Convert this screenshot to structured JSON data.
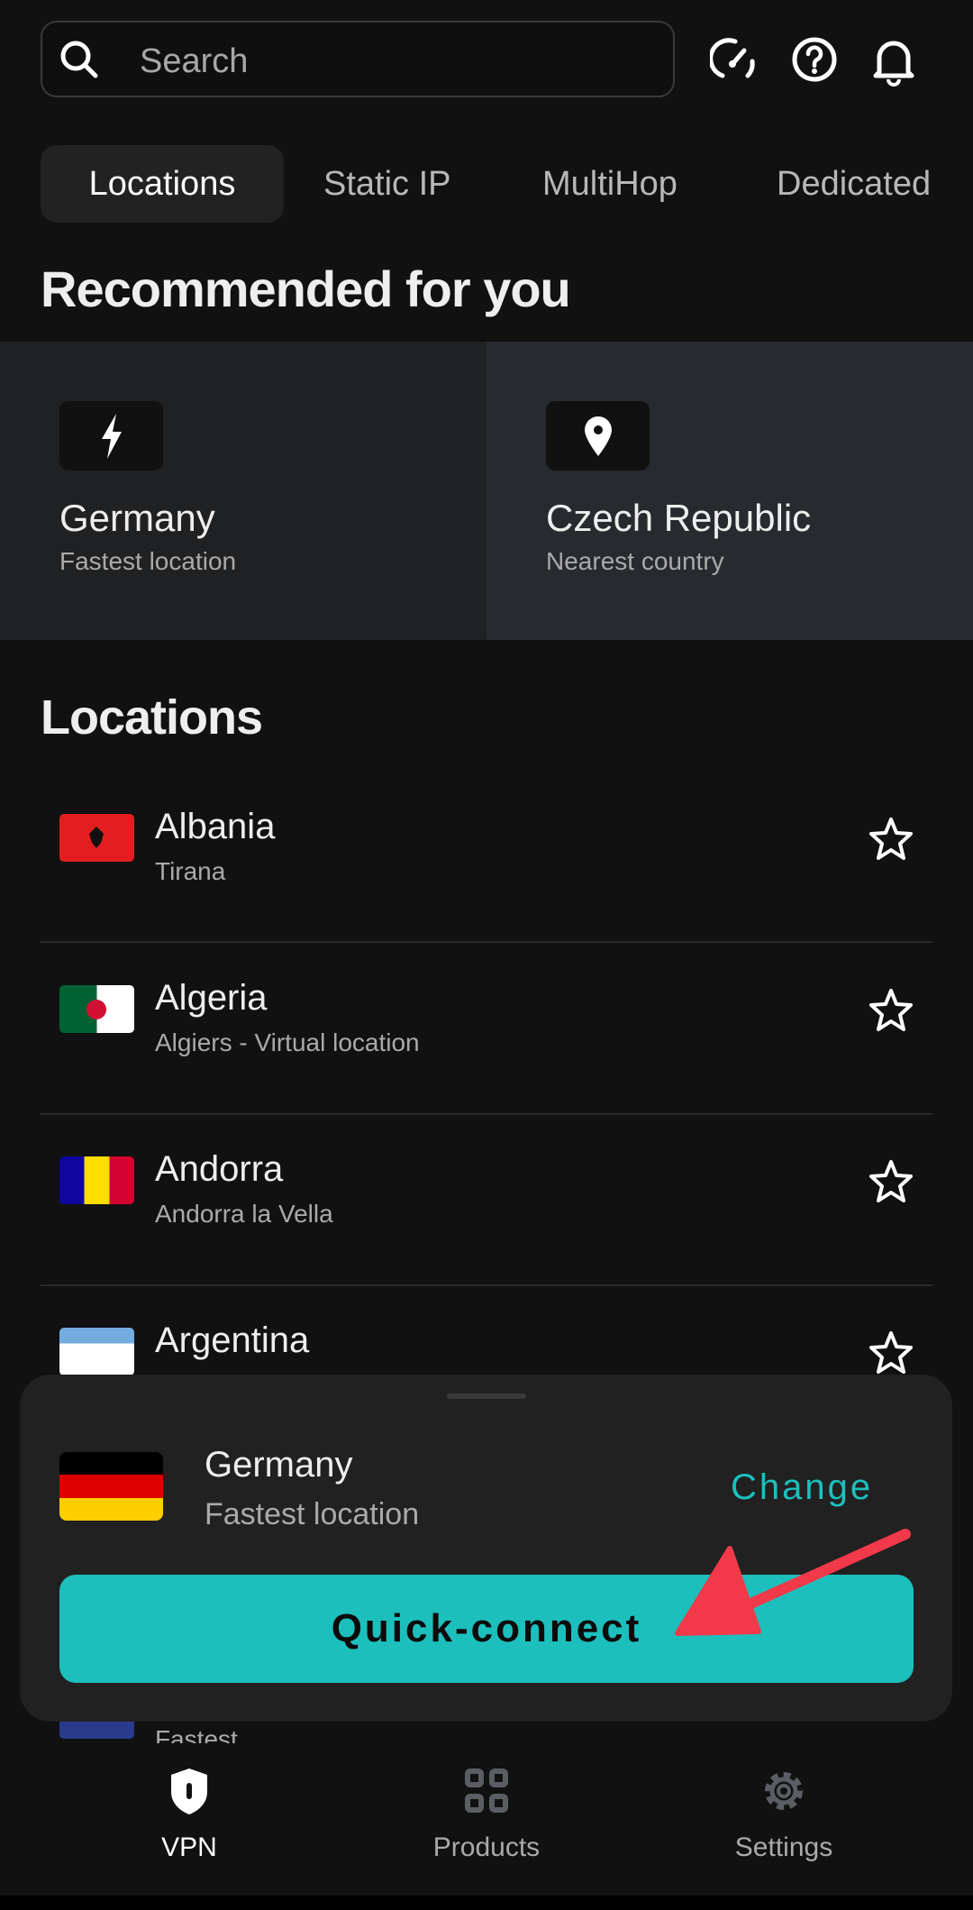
{
  "header": {
    "search_placeholder": "Search",
    "icons": [
      "speedometer-icon",
      "help-icon",
      "bell-icon"
    ]
  },
  "tabs": [
    {
      "label": "Locations",
      "active": true
    },
    {
      "label": "Static IP"
    },
    {
      "label": "MultiHop"
    },
    {
      "label": "Dedicated"
    }
  ],
  "recommended": {
    "title": "Recommended for you",
    "cards": [
      {
        "icon": "lightning-icon",
        "title": "Germany",
        "subtitle": "Fastest location"
      },
      {
        "icon": "location-pin-icon",
        "title": "Czech Republic",
        "subtitle": "Nearest country"
      }
    ]
  },
  "locations": {
    "title": "Locations",
    "items": [
      {
        "name": "Albania",
        "sub": "Tirana"
      },
      {
        "name": "Algeria",
        "sub": "Algiers - Virtual location"
      },
      {
        "name": "Andorra",
        "sub": "Andorra la Vella"
      },
      {
        "name": "Argentina",
        "sub": ""
      }
    ],
    "partial_item_sub": "Fastest"
  },
  "sheet": {
    "country": "Germany",
    "sub": "Fastest location",
    "change": "Change",
    "connect": "Quick-connect"
  },
  "nav": [
    {
      "label": "VPN",
      "active": true
    },
    {
      "label": "Products"
    },
    {
      "label": "Settings"
    }
  ],
  "colors": {
    "accent": "#1dbfbd",
    "annotation_arrow": "#f2394a"
  }
}
